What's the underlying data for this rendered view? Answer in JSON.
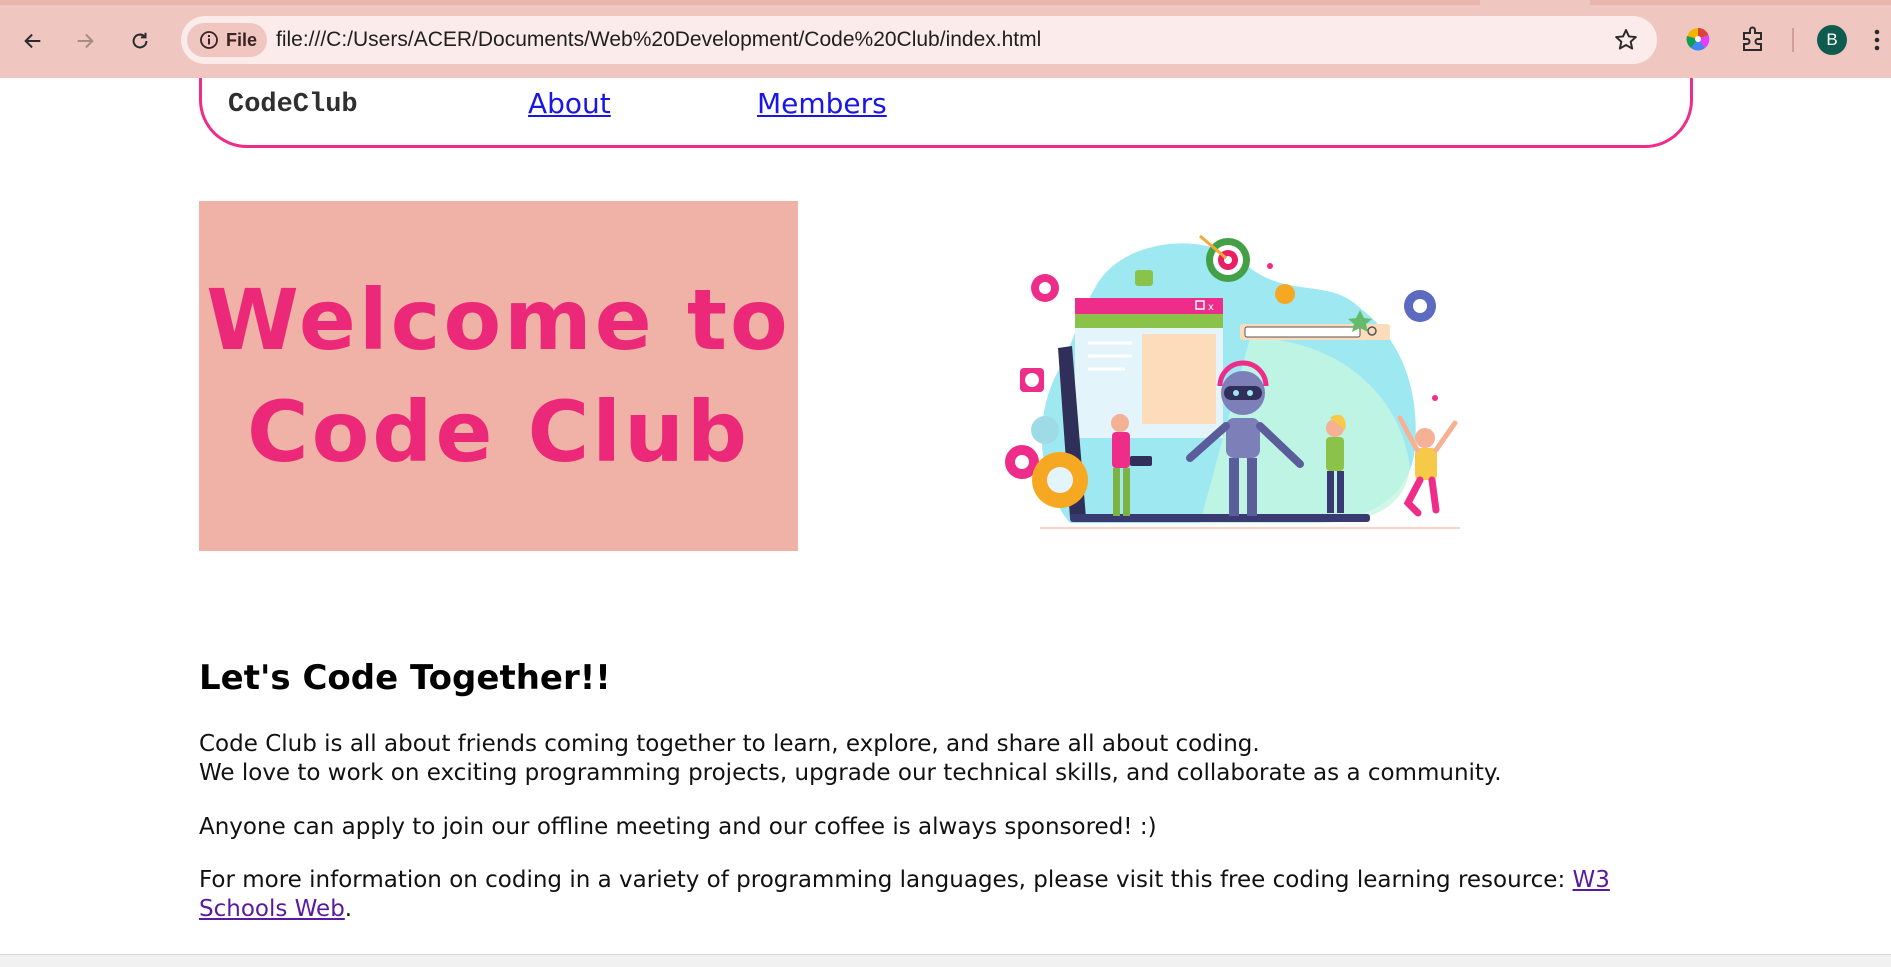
{
  "browser": {
    "chip_label": "File",
    "url": "file:///C:/Users/ACER/Documents/Web%20Development/Code%20Club/index.html",
    "profile_initial": "B",
    "icons": [
      "back-icon",
      "forward-icon",
      "reload-icon",
      "info-icon",
      "star-icon",
      "color-wheel-extension-icon",
      "puzzle-extensions-icon",
      "more-menu-icon"
    ]
  },
  "nav": {
    "brand": "CodeClub",
    "links": [
      "About",
      "Members"
    ]
  },
  "banner": {
    "line1": "Welcome to",
    "line2": "Code Club"
  },
  "content": {
    "heading": "Let's Code Together!!",
    "para1_line1": "Code Club is all about friends coming together to learn, explore, and share all about coding.",
    "para1_line2": "We love to work on exciting programming projects, upgrade our technical skills, and collaborate as a community.",
    "para2": "Anyone can apply to join our offline meeting and our coffee is always sponsored! :)",
    "para3_text": "For more information on coding in a variety of programming languages, please visit this free coding learning resource: ",
    "para3_link": "W3 Schools Web",
    "para3_end": "."
  },
  "colors": {
    "accent_pink": "#ee2c89",
    "banner_bg": "#f0b1a7",
    "banner_text": "#ec2878",
    "link_blue": "#1a16e6",
    "visited_link": "#5a1aa0"
  }
}
